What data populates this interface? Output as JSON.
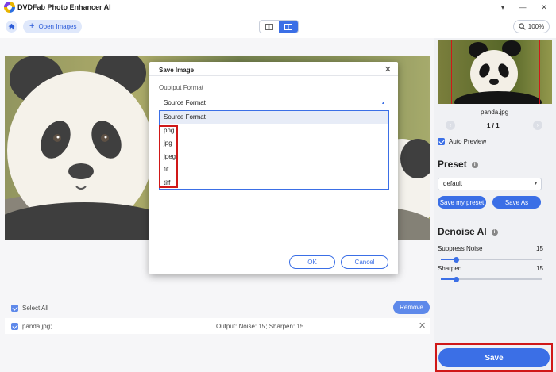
{
  "app": {
    "title": "DVDFab Photo Enhancer AI"
  },
  "window_controls": {
    "menu": "▾",
    "minimize": "—",
    "close": "✕"
  },
  "toolbar": {
    "open_images": "Open Images",
    "zoom": "100%"
  },
  "list": {
    "select_all": "Select All",
    "remove": "Remove",
    "file_name": "panda.jpg;",
    "file_output": "Output: Noise: 15; Sharpen: 15",
    "delete_glyph": "✕"
  },
  "preview": {
    "file_name": "panda.jpg",
    "page": "1 / 1",
    "auto_preview": "Auto Preview"
  },
  "preset": {
    "title": "Preset",
    "selected": "default",
    "save_my_preset": "Save my preset",
    "save_as": "Save As"
  },
  "denoise": {
    "title": "Denoise AI",
    "sliders": [
      {
        "label": "Suppress Noise",
        "value": 15,
        "fraction": 0.15
      },
      {
        "label": "Sharpen",
        "value": 15,
        "fraction": 0.15
      }
    ]
  },
  "save_button": "Save",
  "dialog": {
    "title": "Save Image",
    "close": "✕",
    "format_label": "Ouptput Format",
    "selected_format": "Source Format",
    "options": [
      "Source Format",
      "png",
      "jpg",
      "jpeg",
      "tif",
      "tiff"
    ],
    "ok": "OK",
    "cancel": "Cancel"
  },
  "colors": {
    "accent": "#3b6fe6",
    "highlight": "#d01818",
    "sidebar_bg": "#f0f1f4"
  },
  "icons": [
    "home-icon",
    "plus-icon",
    "single-view-icon",
    "split-view-icon",
    "zoom-icon",
    "info-icon",
    "chevron-down-icon",
    "close-icon"
  ]
}
